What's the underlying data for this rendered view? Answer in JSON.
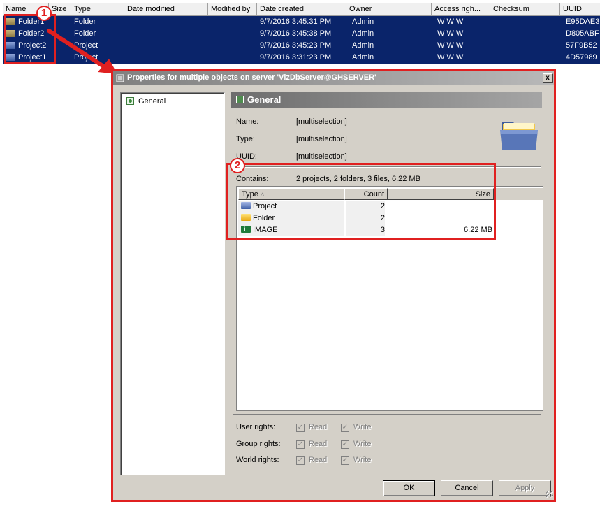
{
  "file_list": {
    "columns": [
      "Name",
      "Size",
      "Type",
      "Date modified",
      "Modified by",
      "Date created",
      "Owner",
      "Access righ...",
      "Checksum",
      "UUID"
    ],
    "rows": [
      {
        "name": "Folder1",
        "type": "Folder",
        "created": "9/7/2016 3:45:31 PM",
        "owner": "Admin",
        "access": "W W W",
        "uuid": "E95DAE3",
        "icon": "folder-icon"
      },
      {
        "name": "Folder2",
        "type": "Folder",
        "created": "9/7/2016 3:45:38 PM",
        "owner": "Admin",
        "access": "W W W",
        "uuid": "D805ABF",
        "icon": "folder-icon"
      },
      {
        "name": "Project2",
        "type": "Project",
        "created": "9/7/2016 3:45:23 PM",
        "owner": "Admin",
        "access": "W W W",
        "uuid": "57F9B52",
        "icon": "project-icon"
      },
      {
        "name": "Project1",
        "type": "Project",
        "created": "9/7/2016 3:31:23 PM",
        "owner": "Admin",
        "access": "W W W",
        "uuid": "4D57989",
        "icon": "project-icon"
      }
    ]
  },
  "annotations": {
    "badge1": "1",
    "badge2": "2",
    "color": "#e02020"
  },
  "dialog": {
    "title": "Properties for multiple objects on server 'VizDbServer@GHSERVER'",
    "close": "x",
    "tree": {
      "items": [
        "General"
      ]
    },
    "header": "General",
    "fields": {
      "name_label": "Name:",
      "name_value": "[multiselection]",
      "type_label": "Type:",
      "type_value": "[multiselection]",
      "uuid_label": "UUID:",
      "uuid_value": "[multiselection]",
      "contains_label": "Contains:",
      "contains_value": "2 projects, 2 folders, 3 files, 6.22 MB"
    },
    "table": {
      "columns": [
        "Type",
        "Count",
        "Size"
      ],
      "rows": [
        {
          "type": "Project",
          "count": "2",
          "size": "",
          "icon": "project-icon"
        },
        {
          "type": "Folder",
          "count": "2",
          "size": "",
          "icon": "folder-icon"
        },
        {
          "type": "IMAGE",
          "count": "3",
          "size": "6.22 MB",
          "icon": "image-icon"
        }
      ]
    },
    "rights": [
      {
        "label": "User rights:",
        "read": "Read",
        "write": "Write"
      },
      {
        "label": "Group rights:",
        "read": "Read",
        "write": "Write"
      },
      {
        "label": "World rights:",
        "read": "Read",
        "write": "Write"
      }
    ],
    "buttons": {
      "ok": "OK",
      "cancel": "Cancel",
      "apply": "Apply"
    }
  },
  "colors": {
    "selection": "#0a246a",
    "dialog_bg": "#d4d0c8",
    "annotation": "#e02020"
  }
}
